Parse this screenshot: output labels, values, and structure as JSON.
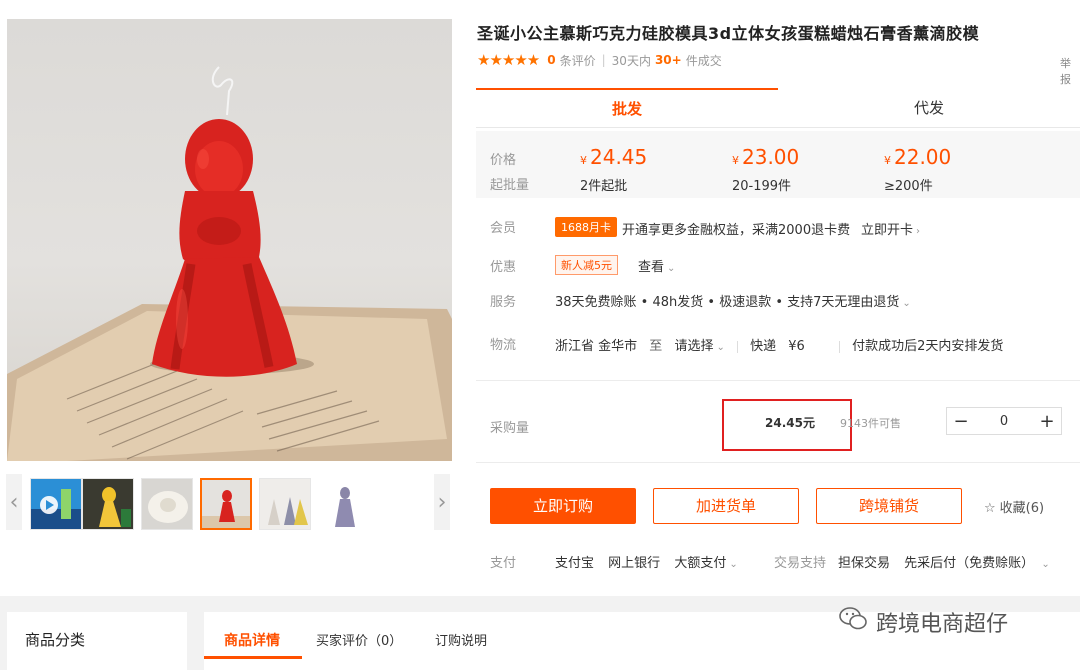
{
  "product": {
    "title": "圣诞小公主慕斯巧克力硅胶模具3d立体女孩蛋糕蜡烛石膏香薰滴胶模",
    "stars": "★★★★★",
    "review_count": "0",
    "review_label": "条评价",
    "sales_prefix": "30天内",
    "sales_count": "30+",
    "sales_suffix": "件成交",
    "report": "举报"
  },
  "mode_tabs": [
    "批发",
    "代发"
  ],
  "price_block": {
    "price_label": "价格",
    "moq_label": "起批量",
    "currency": "¥",
    "tiers": [
      {
        "price": "24.45",
        "qty": "2件起批"
      },
      {
        "price": "23.00",
        "qty": "20-199件"
      },
      {
        "price": "22.00",
        "qty": "≥200件"
      }
    ]
  },
  "member": {
    "label": "会员",
    "badge": "1688月卡",
    "text": "开通享更多金融权益，采满2000退卡费",
    "link": "立即开卡"
  },
  "promo": {
    "label": "优惠",
    "badge": "新人减5元",
    "link": "查看"
  },
  "service": {
    "label": "服务",
    "text": "38天免费赊账 • 48h发货 • 极速退款 • 支持7天无理由退货"
  },
  "logistics": {
    "label": "物流",
    "origin": "浙江省 金华市",
    "to": "至",
    "dest": "请选择",
    "express": "快递",
    "fee": "¥6",
    "ship_note": "付款成功后2天内安排发货"
  },
  "purchase": {
    "label": "采购量",
    "unit_price": "24.45元",
    "stock": "9143件可售",
    "qty": "0",
    "minus": "−",
    "plus": "+"
  },
  "actions": {
    "order": "立即订购",
    "add_cart": "加进货单",
    "cross_border": "跨境铺货",
    "favorite": "收藏(6)"
  },
  "payment": {
    "label": "支付",
    "methods": [
      "支付宝",
      "网上银行",
      "大额支付"
    ],
    "trade_label": "交易支持",
    "trade_items": [
      "担保交易",
      "先采后付（免费赊账）"
    ]
  },
  "bottom": {
    "category_title": "商品分类",
    "detail_tabs": [
      "商品详情",
      "买家评价（0）",
      "订购说明"
    ],
    "watermark": "跨境电商超仔"
  },
  "colors": {
    "accent": "#ff5000",
    "accent_light": "#ff6a00",
    "highlight_box": "#e02020",
    "product_red": "#d8231f"
  },
  "icons": {
    "rating": "star-icon",
    "favorite": "star-outline-icon",
    "thumb_prev": "chevron-left-icon",
    "thumb_next": "chevron-right-icon",
    "dropdown": "chevron-down-icon",
    "watermark": "wechat-icon",
    "video": "play-icon"
  }
}
